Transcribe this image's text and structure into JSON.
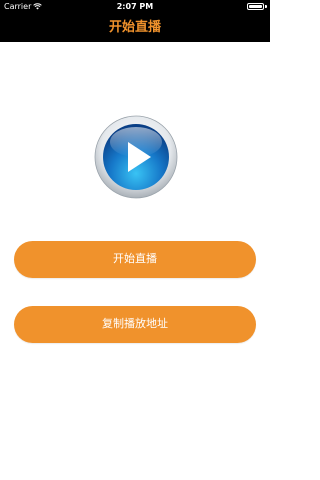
{
  "status_bar": {
    "carrier": "Carrier",
    "wifi_icon": "wifi-icon",
    "time": "2:07 PM",
    "battery_icon": "battery-icon"
  },
  "nav": {
    "title": "开始直播"
  },
  "logo": {
    "icon": "play-icon"
  },
  "buttons": {
    "start_live": "开始直播",
    "copy_url": "复制播放地址"
  },
  "colors": {
    "accent": "#f0922c",
    "topbar": "#000000",
    "background": "#ffffff",
    "logo_blue": "#1e8fd8"
  }
}
